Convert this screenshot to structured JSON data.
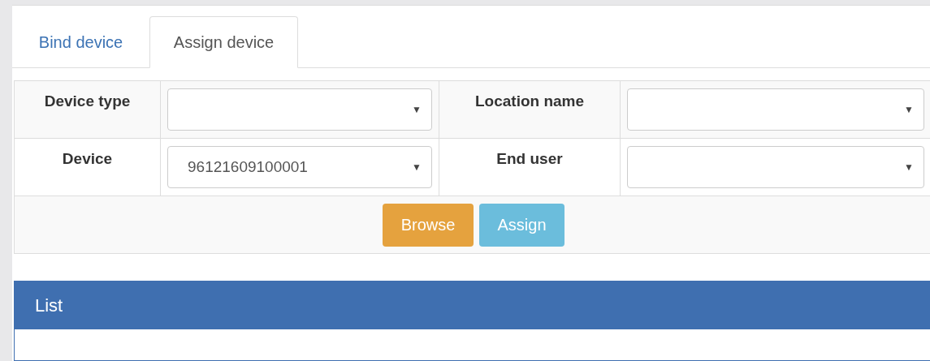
{
  "tabs": [
    {
      "label": "Bind device",
      "selected": false
    },
    {
      "label": "Assign device",
      "selected": true
    }
  ],
  "form": {
    "rows": [
      {
        "fields": [
          {
            "label": "Device type"
          },
          {
            "label": "Location name"
          }
        ]
      },
      {
        "fields": [
          {
            "label": "Device",
            "value": "96121609100001"
          },
          {
            "label": "End user"
          }
        ]
      }
    ],
    "caret": "▼"
  },
  "buttons": [
    {
      "label": "Browse",
      "kind": "warning"
    },
    {
      "label": "Assign",
      "kind": "info"
    }
  ],
  "panel": {
    "title": "List"
  }
}
